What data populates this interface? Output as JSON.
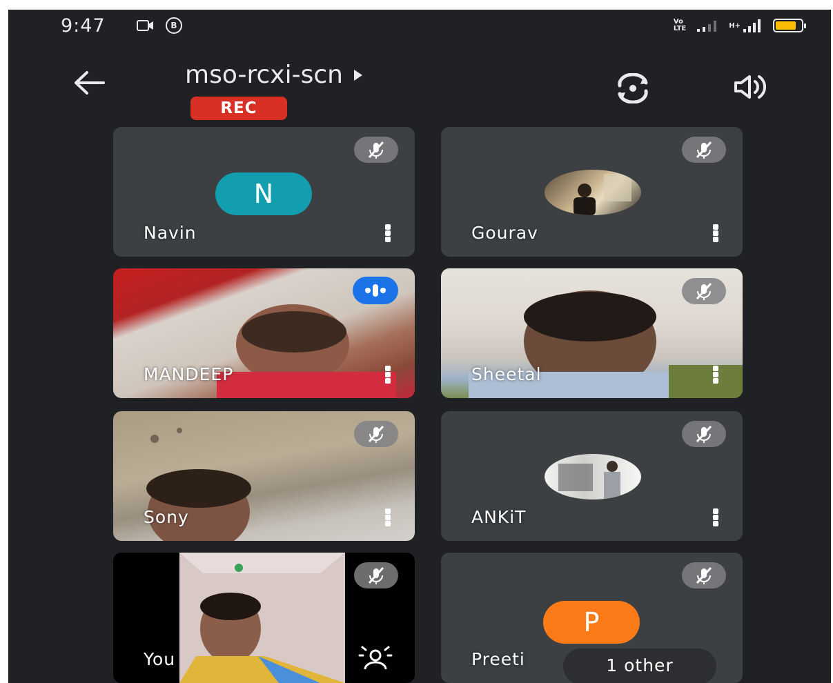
{
  "status_bar": {
    "time": "9:47",
    "volte_top": "Vo",
    "volte_bottom": "LTE",
    "network": "H+",
    "icons": [
      "video-call-icon",
      "b-icon",
      "volte-icon",
      "signal-icon",
      "signal-icon",
      "battery-icon"
    ]
  },
  "header": {
    "title": "mso-rcxi-scn",
    "rec_label": "REC",
    "icons": [
      "back-arrow-icon",
      "play-triangle-icon",
      "switch-camera-icon",
      "speaker-icon"
    ]
  },
  "participants": [
    {
      "name": "Navin",
      "type": "avatar",
      "avatar_letter": "N",
      "avatar_color": "#129eaf",
      "muted": true
    },
    {
      "name": "Gourav",
      "type": "photo",
      "muted": true
    },
    {
      "name": "MANDEEP",
      "type": "video",
      "muted": false,
      "speaking": true
    },
    {
      "name": "Sheetal",
      "type": "video",
      "muted": true
    },
    {
      "name": "Sony",
      "type": "video",
      "muted": true
    },
    {
      "name": "ANKiT",
      "type": "photo",
      "muted": true
    },
    {
      "name": "You",
      "type": "video",
      "muted": true
    },
    {
      "name": "Preeti",
      "type": "avatar",
      "avatar_letter": "P",
      "avatar_color": "#fa7b17",
      "muted": true
    }
  ],
  "others_chip": "1 other",
  "colors": {
    "background": "#202124",
    "tile": "#3c4043",
    "rec": "#d93025",
    "speaking": "#1a73e8"
  }
}
